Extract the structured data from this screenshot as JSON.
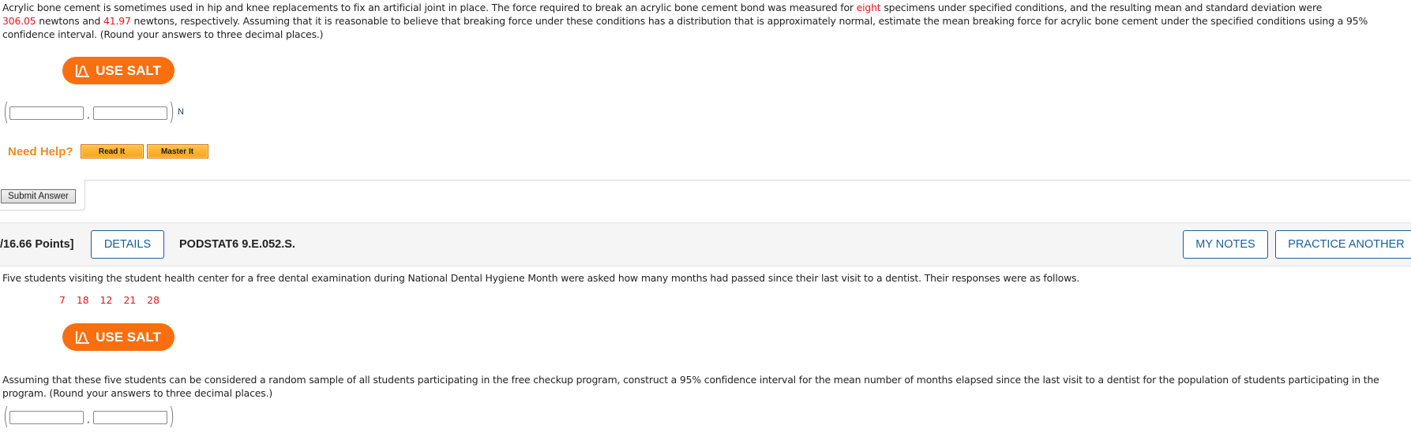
{
  "question1": {
    "text_parts": {
      "line1_a": "Acrylic bone cement is sometimes used in hip and knee replacements to fix an artificial joint in place. The force required to break an acrylic bone cement bond was measured for ",
      "line1_red": "eight",
      "line1_b": " specimens under specified conditions, and the resulting mean and standard deviation were",
      "mean_value": "306.05",
      "mid_text": " newtons and ",
      "sd_value": "41.97",
      "line2_b": " newtons, respectively. Assuming that it is reasonable to believe that breaking force under these conditions has a distribution that is approximately normal, estimate the mean breaking force for acrylic bone cement under the specified conditions using a 95%",
      "line3": "confidence interval. (Round your answers to three decimal places.)"
    },
    "salt_button_label": "USE SALT",
    "interval": {
      "lower_value": "",
      "upper_value": "",
      "unit": "N",
      "open_paren": "(",
      "close_paren": ")",
      "separator": ","
    },
    "need_help": {
      "label": "Need Help?",
      "buttons": [
        "Read It",
        "Master It"
      ]
    },
    "submit_label": "Submit Answer"
  },
  "question2_header": {
    "points_label": "/16.66 Points]",
    "details_label": "DETAILS",
    "question_code": "PODSTAT6 9.E.052.S.",
    "my_notes_label": "MY NOTES",
    "practice_another_label": "PRACTICE ANOTHER"
  },
  "question2": {
    "intro": "Five students visiting the student health center for a free dental examination during National Dental Hygiene Month were asked how many months had passed since their last visit to a dentist. Their responses were as follows.",
    "data_values": [
      "7",
      "18",
      "12",
      "21",
      "28"
    ],
    "salt_button_label": "USE SALT",
    "prompt_line1": "Assuming that these five students can be considered a random sample of all students participating in the free checkup program, construct a 95% confidence interval for the mean number of months elapsed since the last visit to a dentist for the population of students participating in the",
    "prompt_line2": "program. (Round your answers to three decimal places.)",
    "interval": {
      "lower_value": "",
      "upper_value": "",
      "open_paren": "(",
      "close_paren": ")",
      "separator": ","
    }
  },
  "colors": {
    "highlight_red": "#e8151c",
    "salt_orange": "#f96f0f",
    "need_help_orange": "#f08a1c",
    "link_blue": "#1b5e96"
  }
}
